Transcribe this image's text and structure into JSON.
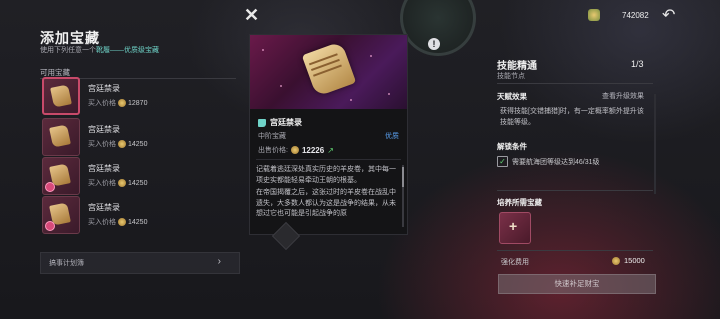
{
  "panel": {
    "title": "添加宝藏",
    "subtitle_prefix": "使用下列任意一个",
    "subtitle_highlight": "靴履——优质级宝藏",
    "section_label": "可用宝藏",
    "items": [
      {
        "name": "宫廷禁录",
        "price_label": "买入价格",
        "price": "12870"
      },
      {
        "name": "宫廷禁录",
        "price_label": "买入价格",
        "price": "14250"
      },
      {
        "name": "宫廷禁录",
        "price_label": "买入价格",
        "price": "14250"
      },
      {
        "name": "宫廷禁录",
        "price_label": "买入价格",
        "price": "14250"
      }
    ],
    "plan_label": "搞事计划簿",
    "plan_chevron": "›"
  },
  "close_icon": "✕",
  "card": {
    "name": "宫廷禁录",
    "grade": "中阶宝藏",
    "quality": "优质",
    "sale_label": "出售价格:",
    "sale_price": "12226",
    "trend": "↗",
    "desc_p1": "记载着逃廷深处真实历史的羊皮卷，其中每一项史实都能轻易牵动王朝的根基。",
    "desc_p2": "在帝国揭覆之后，这张过时的羊皮卷在战乱中遗失，大多数人都认为这是战争的结果，从未想过它也可能是引起战争的原"
  },
  "info_icon": "!",
  "top": {
    "currency": "742082",
    "back_icon": "↶"
  },
  "skill": {
    "title": "技能精通",
    "subtitle": "技能节点",
    "count": "1/3",
    "talent_title": "天赋效果",
    "talent_link": "查看升级效果",
    "talent_desc": "获得技能[交错捕猎]时，有一定概率额外提升该技能等级。",
    "unlock_title": "解锁条件",
    "unlock_req": "需要航海团等级达到46/31级",
    "unlock_check": "✓",
    "req_title": "培养所需宝藏",
    "req_plus": "+",
    "fee_label": "强化费用",
    "fee": "15000",
    "buy_label": "快速补足财宝"
  },
  "colors": {
    "highlight": "#6fd3c8",
    "quality": "#5aa0f0",
    "selected_border": "#c84a6a"
  }
}
